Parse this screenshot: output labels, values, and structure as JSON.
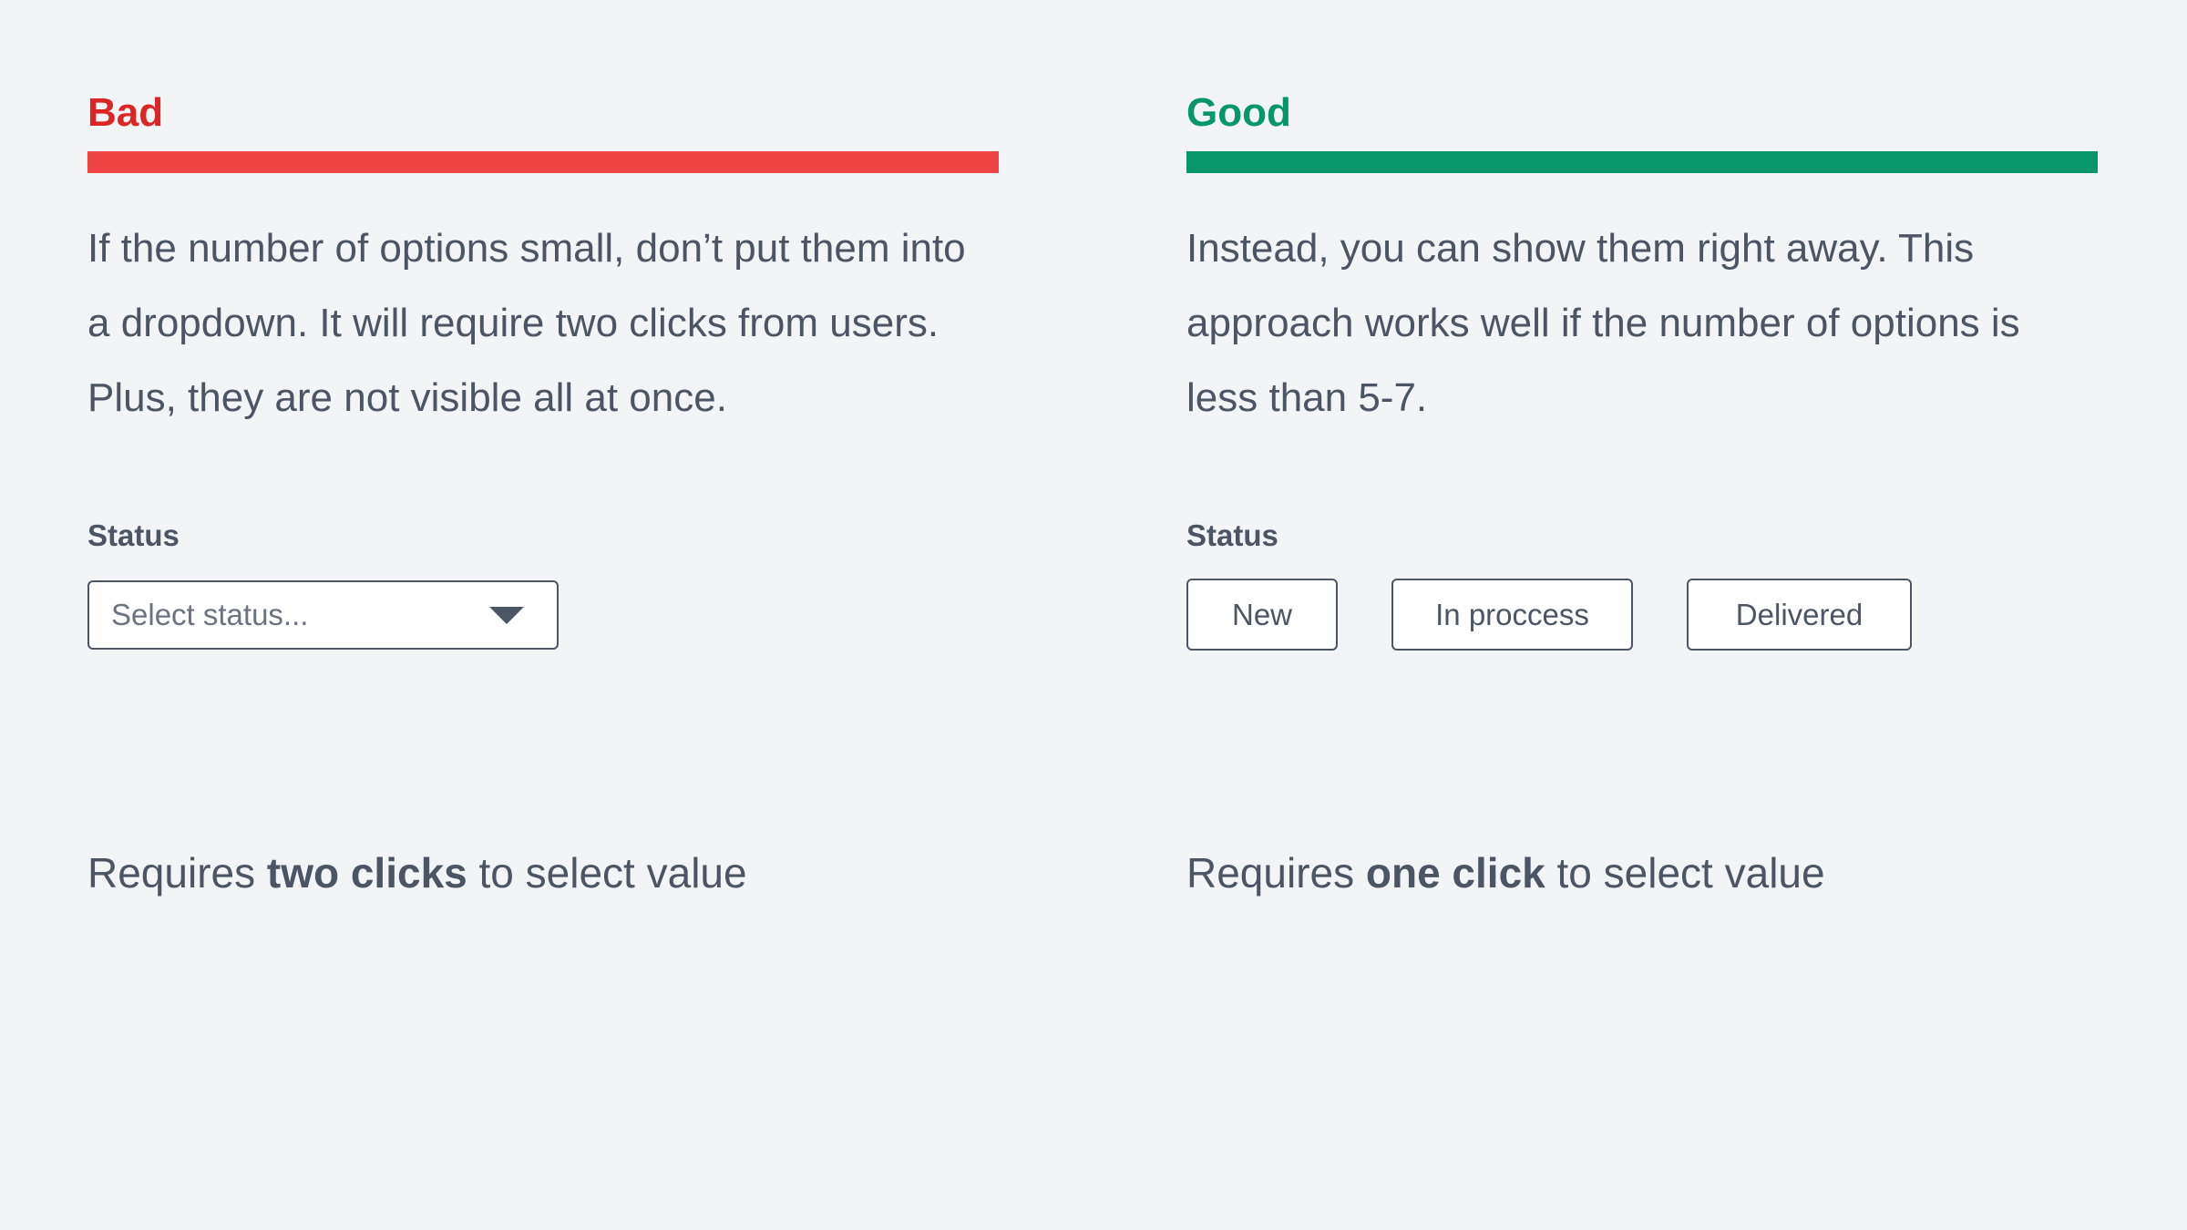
{
  "bad": {
    "heading": "Bad",
    "description": "If the number of options small, don’t put them into a dropdown. It will require two clicks from users. Plus, they are not visible all at once.",
    "field_label": "Status",
    "select_placeholder": "Select status...",
    "summary_prefix": "Requires ",
    "summary_bold": "two clicks",
    "summary_suffix": " to select value"
  },
  "good": {
    "heading": "Good",
    "description": "Instead, you can show them right away. This approach works well if the number of options is less than 5-7.",
    "field_label": "Status",
    "options": [
      {
        "label": "New"
      },
      {
        "label": "In proccess"
      },
      {
        "label": "Delivered"
      }
    ],
    "summary_prefix": "Requires ",
    "summary_bold": "one click",
    "summary_suffix": " to select value"
  },
  "colors": {
    "bad_accent": "#ef4444",
    "bad_text": "#dc2626",
    "good_accent": "#059669",
    "text": "#4b5563",
    "background": "#f3f4f6"
  },
  "icons": {
    "dropdown": "caret-down-icon"
  }
}
